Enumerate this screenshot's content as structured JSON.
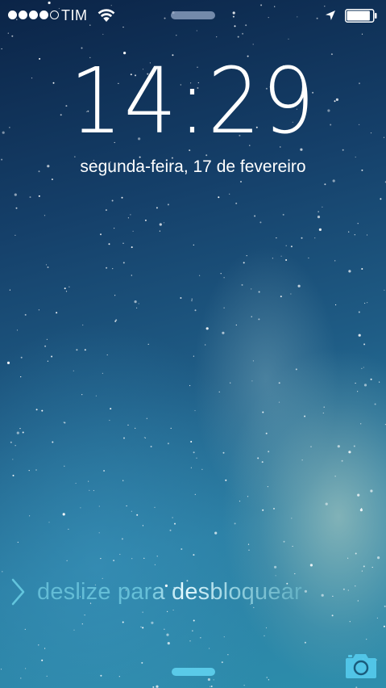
{
  "status_bar": {
    "signal_bars_filled": 4,
    "signal_bars_total": 5,
    "carrier": "TIM",
    "wifi_icon": "wifi-icon",
    "location_icon": "location-arrow-icon",
    "battery_icon": "battery-icon",
    "battery_level": 0.9
  },
  "lock_screen": {
    "time": "14:29",
    "date": "segunda-feira, 17 de fevereiro",
    "unlock_label": "deslize para desbloquear",
    "camera_icon": "camera-icon"
  },
  "colors": {
    "text": "#ffffff",
    "accent": "#5fd0ee"
  }
}
